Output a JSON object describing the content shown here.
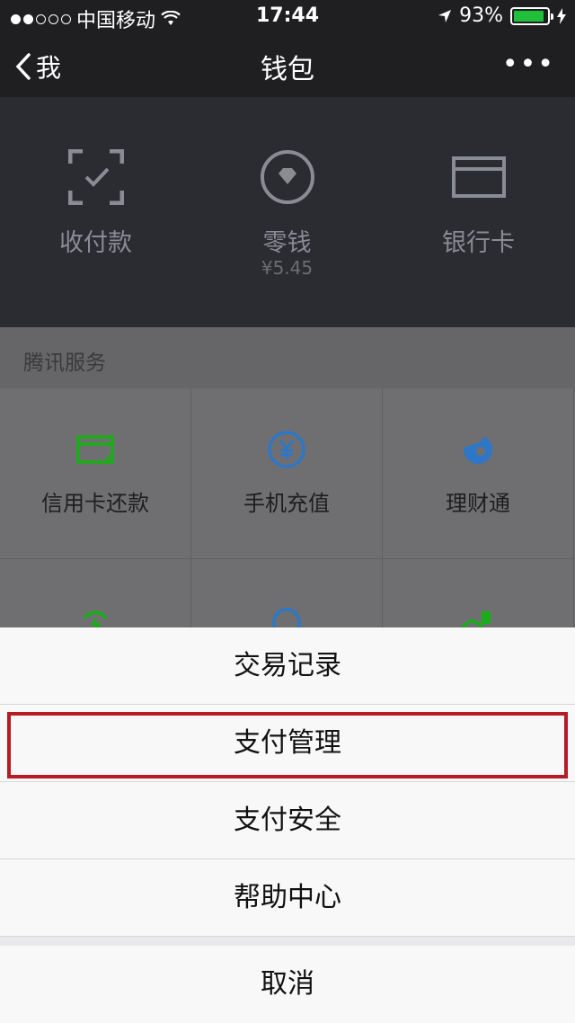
{
  "status_bar": {
    "carrier": "中国移动",
    "time": "17:44",
    "battery": "93%"
  },
  "nav": {
    "back_label": "我",
    "title": "钱包"
  },
  "wallet": [
    {
      "label": "收付款"
    },
    {
      "label": "零钱",
      "balance": "¥5.45"
    },
    {
      "label": "银行卡"
    }
  ],
  "section": {
    "title": "腾讯服务"
  },
  "services": [
    {
      "label": "信用卡还款"
    },
    {
      "label": "手机充值"
    },
    {
      "label": "理财通"
    }
  ],
  "action_sheet": {
    "items": [
      "交易记录",
      "支付管理",
      "支付安全",
      "帮助中心"
    ],
    "cancel": "取消"
  },
  "colors": {
    "green": "#1aad19",
    "blue": "#2d77c6",
    "highlight": "#b51c24"
  }
}
